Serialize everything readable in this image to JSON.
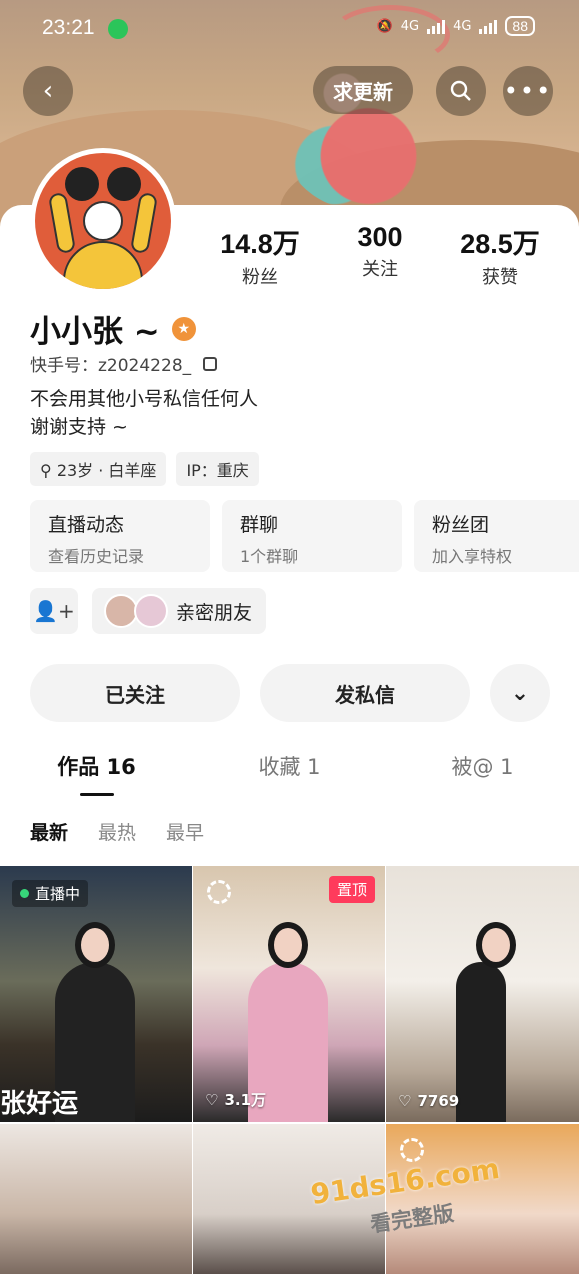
{
  "status_bar": {
    "time": "23:21",
    "battery": "88",
    "network": "4G"
  },
  "header": {
    "request_update_label": "求更新"
  },
  "profile": {
    "name": "小小张 ~",
    "kuaishou_id": "快手号：z2024228_",
    "bio_line1": "不会用其他小号私信任何人",
    "bio_line2": "谢谢支持 ~",
    "tags": [
      "23岁 · 白羊座",
      "IP：重庆"
    ]
  },
  "stats": [
    {
      "value": "14.8万",
      "label": "粉丝"
    },
    {
      "value": "300",
      "label": "关注"
    },
    {
      "value": "28.5万",
      "label": "获赞"
    }
  ],
  "tiles": [
    {
      "title": "直播动态",
      "subtitle": "查看历史记录"
    },
    {
      "title": "群聊",
      "subtitle": "1个群聊"
    },
    {
      "title": "粉丝团",
      "subtitle": "加入享特权"
    }
  ],
  "friends": {
    "close_friends_label": "亲密朋友"
  },
  "actions": {
    "following_label": "已关注",
    "message_label": "发私信"
  },
  "tabs": [
    {
      "label": "作品 16"
    },
    {
      "label": "收藏 1"
    },
    {
      "label": "被@ 1"
    }
  ],
  "sort": {
    "newest": "最新",
    "hottest": "最热",
    "earliest": "最早"
  },
  "grid": {
    "live_label": "直播中",
    "overlay_caption": "张好运",
    "pinned_label": "置顶",
    "likes_2": "3.1万",
    "likes_3": "7769"
  },
  "watermark": {
    "line1": "91ds16.com",
    "line2": "看完整版"
  }
}
